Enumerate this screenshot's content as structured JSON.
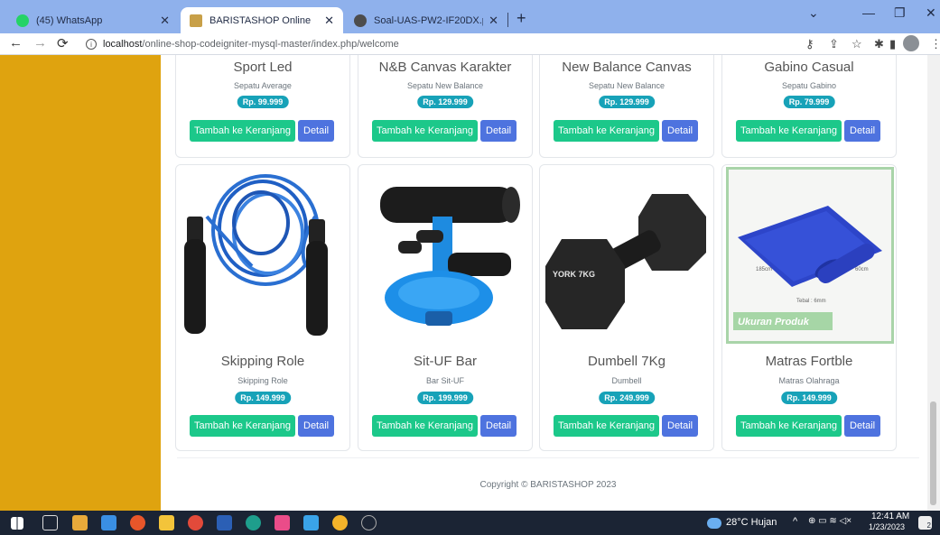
{
  "browser": {
    "tabs": [
      {
        "label": "(45) WhatsApp",
        "icon": "whatsapp-icon",
        "color": "#25d366"
      },
      {
        "label": "BARISTASHOP Online",
        "icon": "site-icon",
        "color": "#c8a048"
      },
      {
        "label": "Soal-UAS-PW2-IF20DX.pdf",
        "icon": "chrome-icon",
        "color": "#555555"
      }
    ],
    "url_host": "localhost",
    "url_path": "/online-shop-codeigniter-mysql-master/index.php/welcome"
  },
  "top_products": [
    {
      "title": "Sport Led",
      "sub": "Sepatu Average",
      "price": "Rp. 99.999"
    },
    {
      "title": "N&B Canvas Karakter",
      "sub": "Sepatu New Balance",
      "price": "Rp. 129.999"
    },
    {
      "title": "New Balance Canvas",
      "sub": "Sepatu New Balance",
      "price": "Rp. 129.999"
    },
    {
      "title": "Gabino Casual",
      "sub": "Sepatu Gabino",
      "price": "Rp. 79.999"
    }
  ],
  "products": [
    {
      "title": "Skipping Role",
      "sub": "Skipping Role",
      "price": "Rp. 149.999"
    },
    {
      "title": "Sit-UF Bar",
      "sub": "Bar Sit-UF",
      "price": "Rp. 199.999"
    },
    {
      "title": "Dumbell 7Kg",
      "sub": "Dumbell",
      "price": "Rp. 249.999"
    },
    {
      "title": "Matras Fortble",
      "sub": "Matras Olahraga",
      "price": "Rp. 149.999"
    }
  ],
  "buttons": {
    "cart": "Tambah ke Keranjang",
    "detail": "Detail"
  },
  "images": {
    "dumbbell_text": "YORK 7KG",
    "mat_width": "185cm",
    "mat_length": "60cm",
    "mat_thickness": "Tebal : 6mm",
    "mat_caption": "Ukuran Produk"
  },
  "footer": "Copyright © BARISTASHOP 2023",
  "taskbar": {
    "weather": "28°C Hujan",
    "time": "12:41 AM",
    "date": "1/23/2023",
    "notif_count": "2"
  }
}
